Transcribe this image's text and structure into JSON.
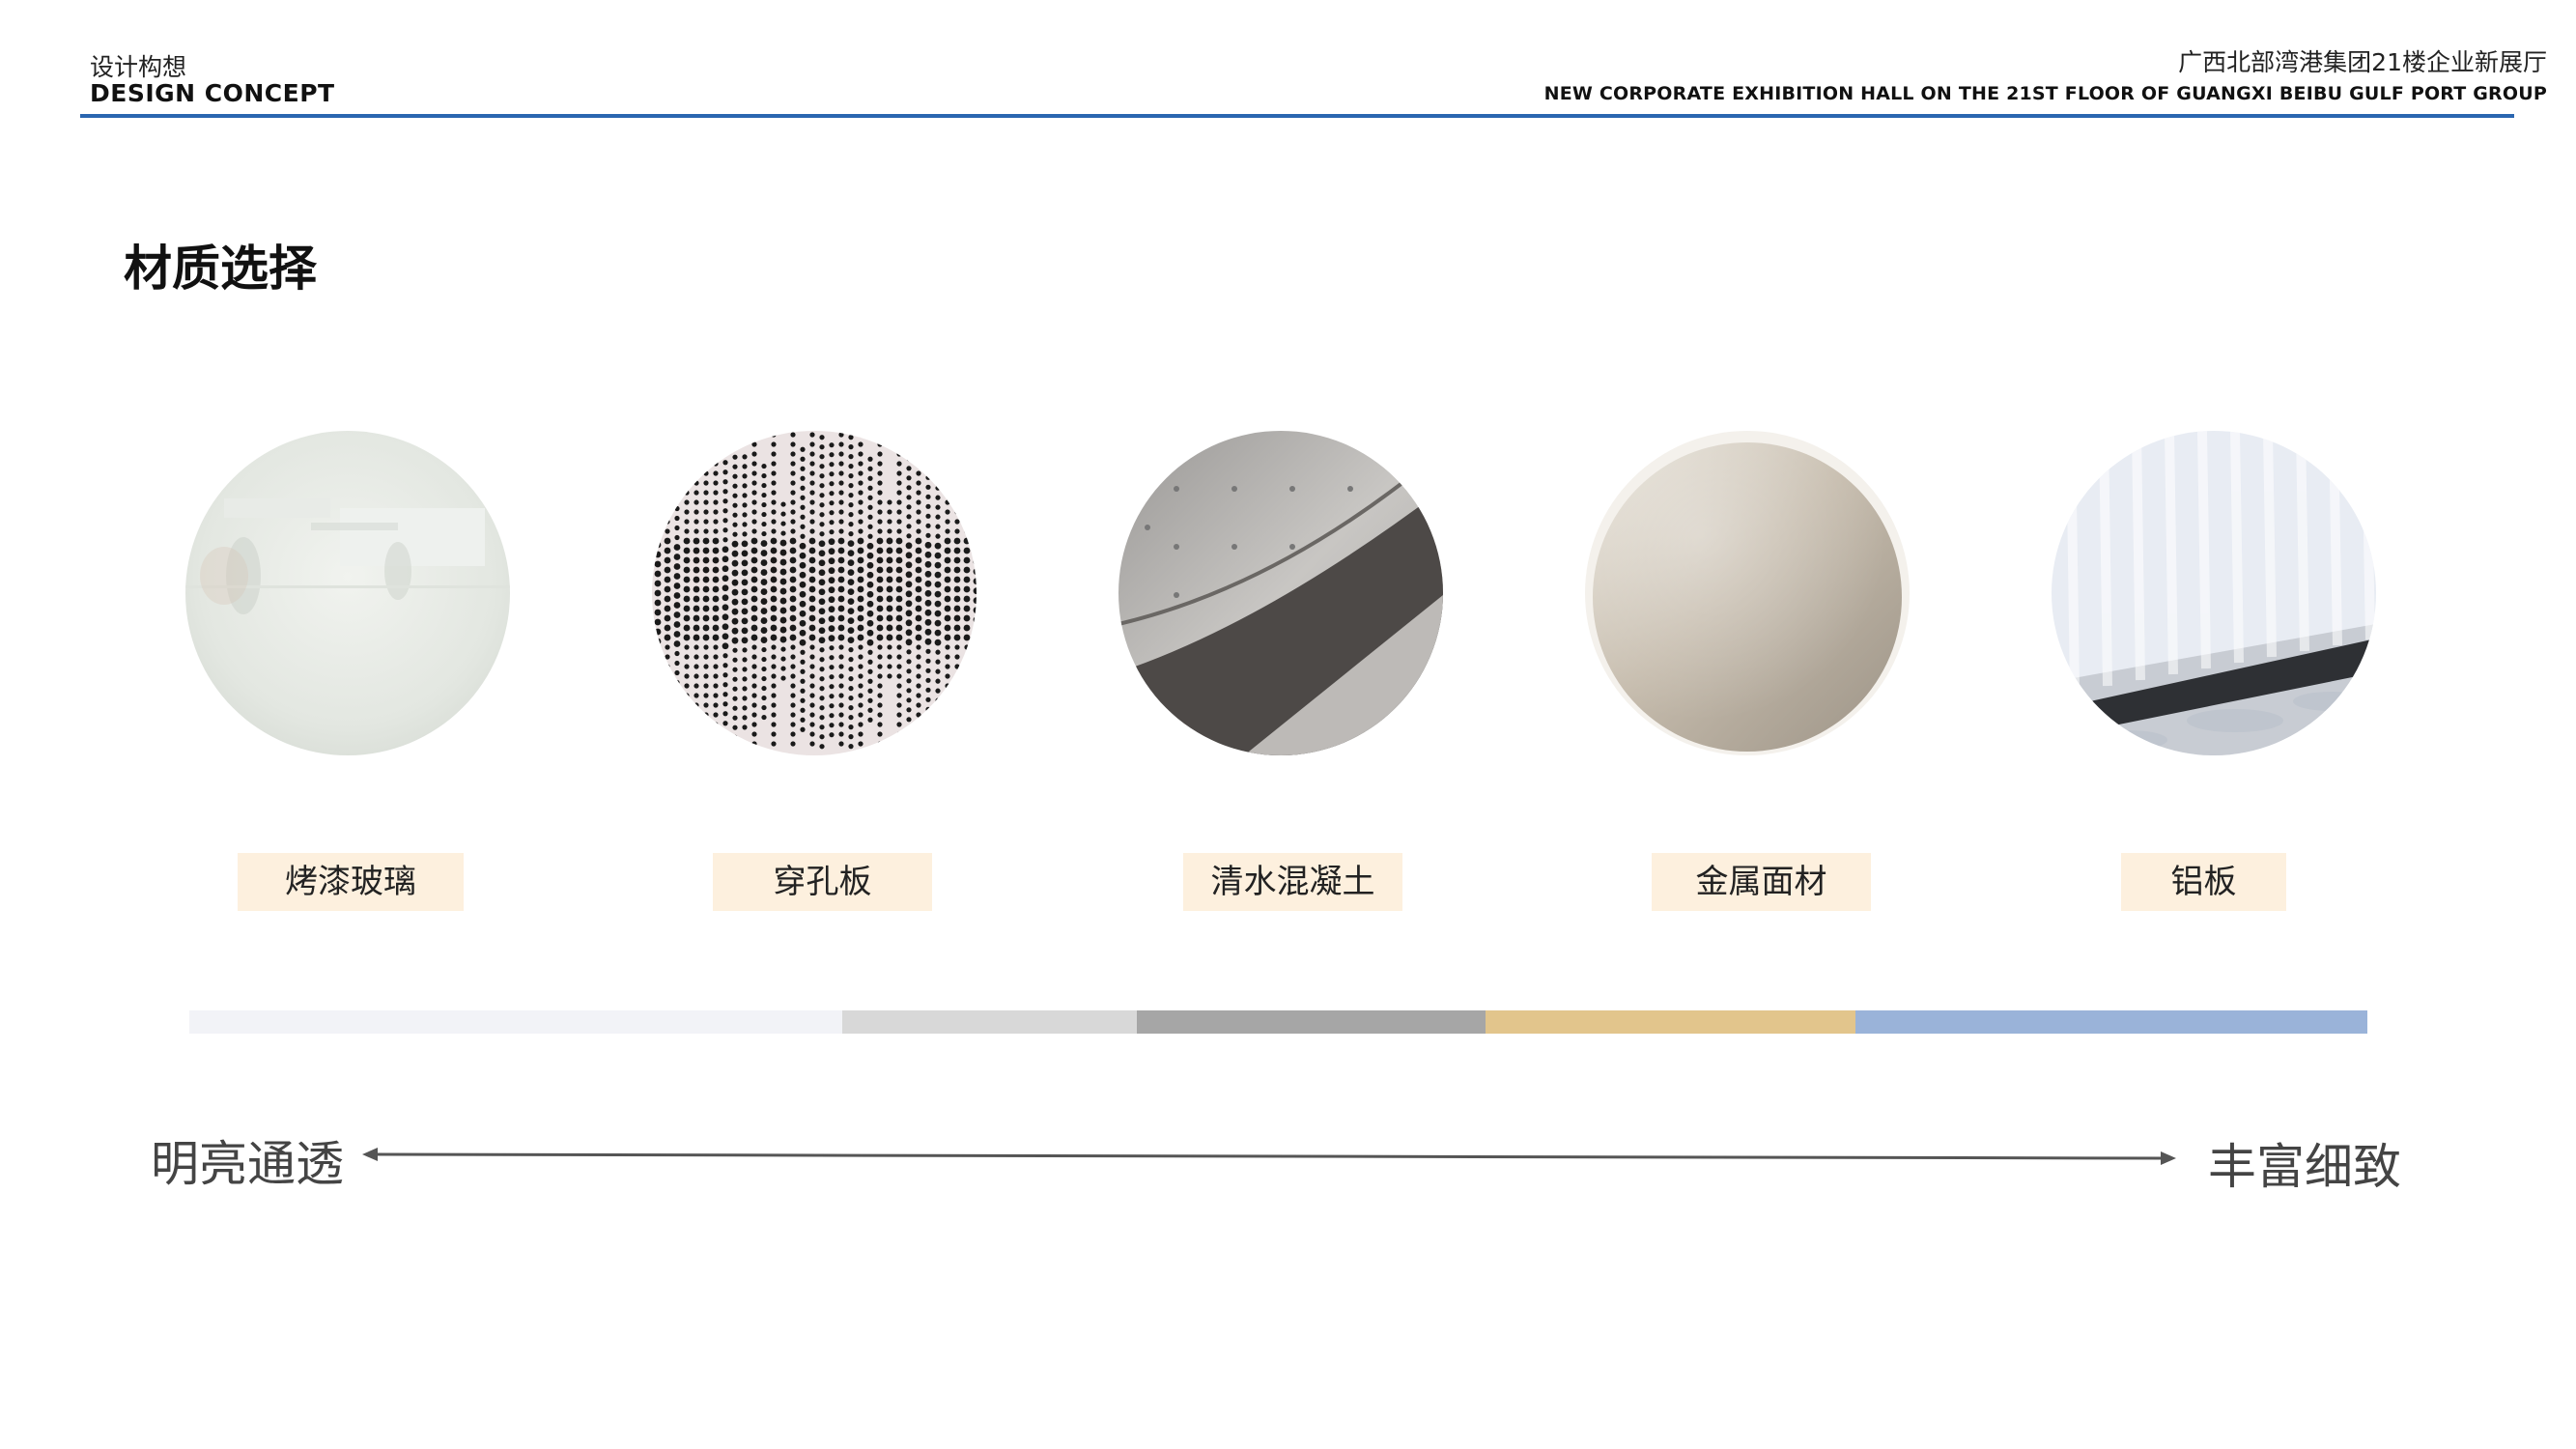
{
  "header": {
    "section_cn": "设计构想",
    "section_en": "DESIGN CONCEPT",
    "project_cn": "广西北部湾港集团21楼企业新展厅",
    "project_en": "NEW CORPORATE EXHIBITION HALL ON THE 21ST FLOOR OF GUANGXI BEIBU GULF PORT GROUP",
    "rule_color": "#2a66b0"
  },
  "page_title": "材质选择",
  "materials": [
    {
      "label": "烤漆玻璃",
      "swatch": "frosted-glass-image"
    },
    {
      "label": "穿孔板",
      "swatch": "perforated-panel-image"
    },
    {
      "label": "清水混凝土",
      "swatch": "fair-faced-concrete-image"
    },
    {
      "label": "金属面材",
      "swatch": "brushed-metal-image"
    },
    {
      "label": "铝板",
      "swatch": "aluminum-panel-image"
    }
  ],
  "spectrum": {
    "colors": [
      "#f2f3f7",
      "#d8d8d8",
      "#a6a6a6",
      "#e2c58c",
      "#9ab3d9"
    ],
    "left_label": "明亮通透",
    "right_label": "丰富细致"
  }
}
